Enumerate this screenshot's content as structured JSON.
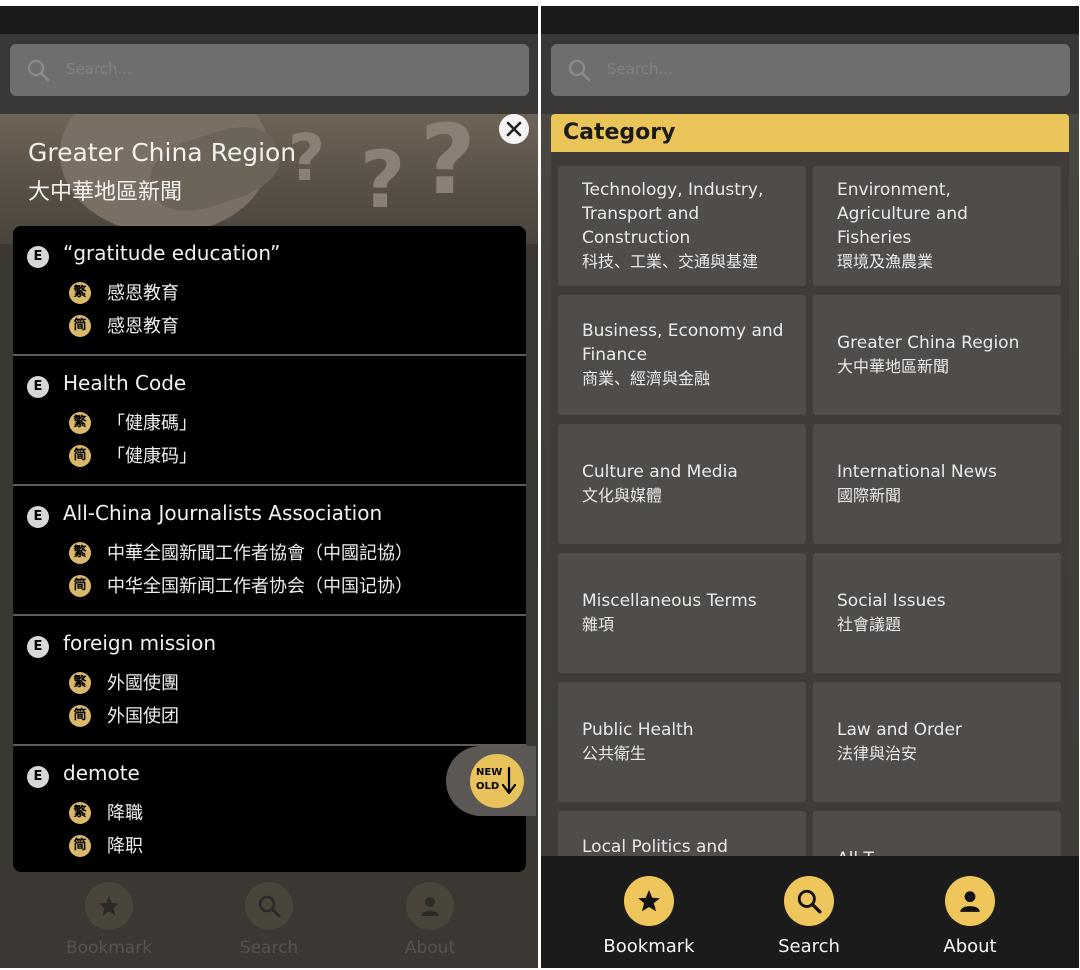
{
  "left": {
    "search": {
      "placeholder": "Search..."
    },
    "hero": {
      "title": "Greater China Region",
      "subtitle": "大中華地區新聞"
    },
    "badges": {
      "english": "E",
      "traditional": "繁",
      "simplified": "简"
    },
    "terms": [
      {
        "en": "“gratitude education”",
        "trad": "感恩教育",
        "simp": "感恩教育"
      },
      {
        "en": "Health Code",
        "trad": "「健康碼」",
        "simp": "「健康码」"
      },
      {
        "en": "All-China Journalists Association",
        "trad": "中華全國新聞工作者協會（中國記協）",
        "simp": "中华全国新闻工作者协会（中国记协）"
      },
      {
        "en": "foreign mission",
        "trad": "外國使團",
        "simp": "外国使团"
      },
      {
        "en": "demote",
        "trad": "降職",
        "simp": "降职"
      }
    ],
    "sort": {
      "new": "NEW",
      "old": "OLD"
    },
    "nav": {
      "bookmark": "Bookmark",
      "search": "Search",
      "about": "About"
    }
  },
  "right": {
    "search": {
      "placeholder": "Search..."
    },
    "category_title": "Category",
    "categories": [
      {
        "en": "Technology, Industry, Transport and Construction",
        "zh": "科技、工業、交通與基建"
      },
      {
        "en": "Environment, Agriculture and Fisheries",
        "zh": "環境及漁農業"
      },
      {
        "en": "Business, Economy and Finance",
        "zh": "商業、經濟與金融"
      },
      {
        "en": "Greater China Region",
        "zh": "大中華地區新聞"
      },
      {
        "en": "Culture and Media",
        "zh": "文化與媒體"
      },
      {
        "en": "International News",
        "zh": "國際新聞"
      },
      {
        "en": "Miscellaneous Terms",
        "zh": "雜項"
      },
      {
        "en": "Social Issues",
        "zh": "社會議題"
      },
      {
        "en": "Public Health",
        "zh": "公共衛生"
      },
      {
        "en": "Law and Order",
        "zh": "法律與治安"
      },
      {
        "en": "Local Politics and",
        "zh": ""
      },
      {
        "en": "All T",
        "zh": ""
      }
    ],
    "nav": {
      "bookmark": "Bookmark",
      "search": "Search",
      "about": "About"
    }
  },
  "colors": {
    "accent": "#e9c458",
    "traditional_badge": "#d9b86a",
    "panel_bg": "#2b2927"
  },
  "icons": [
    "search-icon",
    "close-icon",
    "star-icon",
    "magnifier-icon",
    "user-icon",
    "down-arrow-icon"
  ]
}
